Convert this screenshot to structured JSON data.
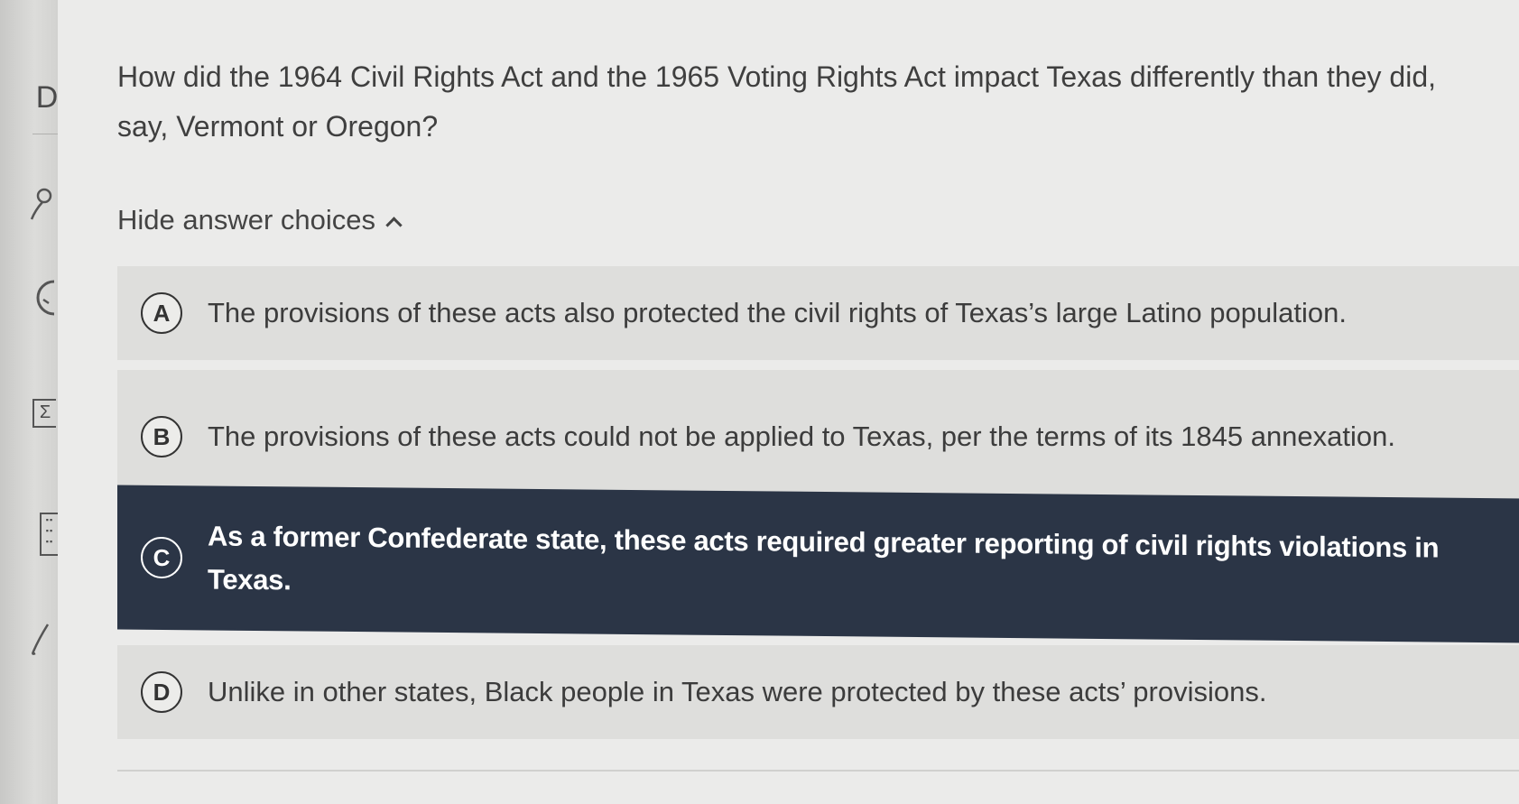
{
  "sidebar": {
    "letter": "D",
    "icons": [
      "person-icon",
      "clock-icon",
      "sigma-icon",
      "calculator-icon",
      "pen-icon"
    ]
  },
  "question": {
    "text": "How did the 1964 Civil Rights Act and the 1965 Voting Rights Act impact Texas differently than they did, say, Vermont or Oregon?"
  },
  "toggle": {
    "label": "Hide answer choices"
  },
  "choices": [
    {
      "letter": "A",
      "text": "The provisions of these acts also protected the civil rights of Texas’s large Latino population.",
      "selected": false
    },
    {
      "letter": "B",
      "text": "The provisions of these acts could not be applied to Texas, per the terms of its 1845 annexation.",
      "selected": false
    },
    {
      "letter": "C",
      "text": "As a former Confederate state, these acts required greater reporting of civil rights violations in Texas.",
      "selected": true
    },
    {
      "letter": "D",
      "text": "Unlike in other states, Black people in Texas were protected by these acts’ provisions.",
      "selected": false
    }
  ],
  "colors": {
    "selected_bg": "#2b3546",
    "choice_bg": "#dededc",
    "page_bg": "#ebebea"
  }
}
